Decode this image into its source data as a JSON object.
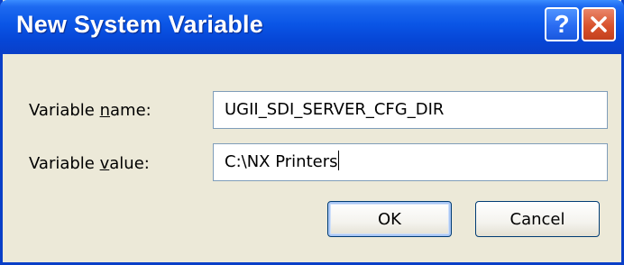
{
  "window": {
    "title": "New System Variable"
  },
  "titlebar_buttons": {
    "help_glyph": "?",
    "close_icon": "close-x-icon"
  },
  "form": {
    "name_label_pre": "Variable ",
    "name_label_ul": "n",
    "name_label_post": "ame:",
    "name_value": "UGII_SDI_SERVER_CFG_DIR",
    "value_label_pre": "Variable ",
    "value_label_ul": "v",
    "value_label_post": "alue:",
    "value_value": "C:\\NX Printers"
  },
  "buttons": {
    "ok_label": "OK",
    "cancel_label": "Cancel"
  },
  "colors": {
    "titlebar": "#0a55e6",
    "close_button": "#d9532d",
    "dialog_bg": "#ece9d8",
    "field_border": "#7f9db9"
  }
}
